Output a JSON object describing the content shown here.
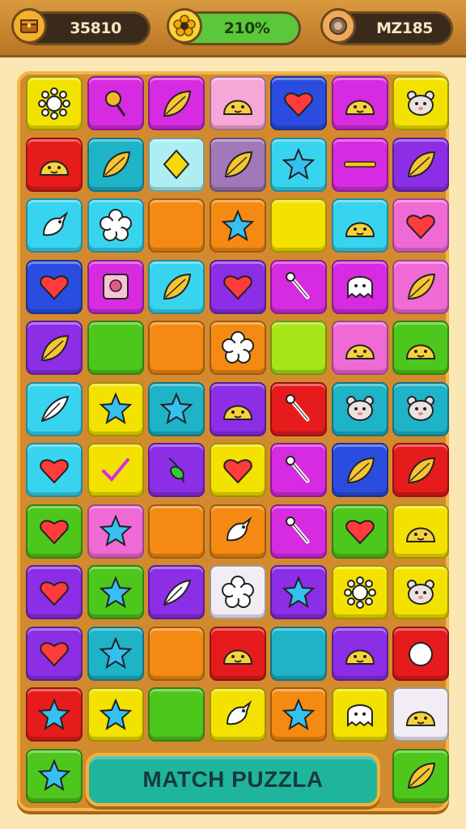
{
  "hud": {
    "coins": "35810",
    "progress": "210%",
    "level": "MZ185"
  },
  "colors": {
    "yellow": "#f3e200",
    "magenta": "#d62be0",
    "pink": "#f06ad6",
    "lightpink": "#f7a6d8",
    "blue": "#2a4de0",
    "lime": "#a8e619",
    "red": "#e61b1b",
    "teal": "#1fb3c7",
    "cyan": "#38d4ef",
    "orange": "#f58a12",
    "purple": "#8c2ee6",
    "green": "#4ec71c",
    "mauve": "#a178b8",
    "white": "#f2ecf4",
    "paleblue": "#aeeef2"
  },
  "board": {
    "rows": [
      [
        {
          "c": "yellow",
          "i": "sun"
        },
        {
          "c": "magenta",
          "i": "lollipop"
        },
        {
          "c": "magenta",
          "i": "leaf"
        },
        {
          "c": "lightpink",
          "i": "face"
        },
        {
          "c": "blue",
          "i": "heart"
        },
        {
          "c": "magenta",
          "i": "face"
        },
        {
          "c": "yellow",
          "i": "bear"
        }
      ],
      [
        {
          "c": "red",
          "i": "face"
        },
        {
          "c": "teal",
          "i": "leaf"
        },
        {
          "c": "paleblue",
          "i": "diamond"
        },
        {
          "c": "mauve",
          "i": "leaf"
        },
        {
          "c": "cyan",
          "i": "star"
        },
        {
          "c": "magenta",
          "i": "bar"
        },
        {
          "c": "purple",
          "i": "leaf"
        }
      ],
      [
        {
          "c": "cyan",
          "i": "bird"
        },
        {
          "c": "cyan",
          "i": "flower"
        },
        {
          "c": "orange",
          "i": "none"
        },
        {
          "c": "orange",
          "i": "star"
        },
        {
          "c": "yellow",
          "i": "none"
        },
        {
          "c": "cyan",
          "i": "face"
        },
        {
          "c": "pink",
          "i": "heart"
        }
      ],
      [
        {
          "c": "blue",
          "i": "heart"
        },
        {
          "c": "magenta",
          "i": "box"
        },
        {
          "c": "cyan",
          "i": "leaf"
        },
        {
          "c": "purple",
          "i": "heart"
        },
        {
          "c": "magenta",
          "i": "stick"
        },
        {
          "c": "magenta",
          "i": "ghost"
        },
        {
          "c": "pink",
          "i": "leaf"
        }
      ],
      [
        {
          "c": "purple",
          "i": "leaf"
        },
        {
          "c": "green",
          "i": "none"
        },
        {
          "c": "orange",
          "i": "none"
        },
        {
          "c": "orange",
          "i": "flower"
        },
        {
          "c": "lime",
          "i": "none"
        },
        {
          "c": "pink",
          "i": "face"
        },
        {
          "c": "green",
          "i": "face"
        }
      ],
      [
        {
          "c": "cyan",
          "i": "feather"
        },
        {
          "c": "yellow",
          "i": "star"
        },
        {
          "c": "teal",
          "i": "star"
        },
        {
          "c": "purple",
          "i": "face"
        },
        {
          "c": "red",
          "i": "stick"
        },
        {
          "c": "teal",
          "i": "bear"
        },
        {
          "c": "teal",
          "i": "bear"
        }
      ],
      [
        {
          "c": "cyan",
          "i": "heart"
        },
        {
          "c": "yellow",
          "i": "check"
        },
        {
          "c": "purple",
          "i": "sprout"
        },
        {
          "c": "yellow",
          "i": "heart"
        },
        {
          "c": "magenta",
          "i": "stick"
        },
        {
          "c": "blue",
          "i": "leaf"
        },
        {
          "c": "red",
          "i": "leaf"
        }
      ],
      [
        {
          "c": "green",
          "i": "heart"
        },
        {
          "c": "pink",
          "i": "star"
        },
        {
          "c": "orange",
          "i": "none"
        },
        {
          "c": "orange",
          "i": "bird"
        },
        {
          "c": "magenta",
          "i": "stick"
        },
        {
          "c": "green",
          "i": "heart"
        },
        {
          "c": "yellow",
          "i": "face"
        }
      ],
      [
        {
          "c": "purple",
          "i": "heart"
        },
        {
          "c": "green",
          "i": "star"
        },
        {
          "c": "purple",
          "i": "feather"
        },
        {
          "c": "white",
          "i": "flower"
        },
        {
          "c": "purple",
          "i": "star"
        },
        {
          "c": "yellow",
          "i": "sun"
        },
        {
          "c": "yellow",
          "i": "bear"
        }
      ],
      [
        {
          "c": "purple",
          "i": "heart"
        },
        {
          "c": "teal",
          "i": "star"
        },
        {
          "c": "orange",
          "i": "none"
        },
        {
          "c": "red",
          "i": "face"
        },
        {
          "c": "teal",
          "i": "none"
        },
        {
          "c": "purple",
          "i": "face"
        },
        {
          "c": "red",
          "i": "ball"
        }
      ],
      [
        {
          "c": "red",
          "i": "star"
        },
        {
          "c": "yellow",
          "i": "star"
        },
        {
          "c": "green",
          "i": "none"
        },
        {
          "c": "yellow",
          "i": "bird"
        },
        {
          "c": "orange",
          "i": "star"
        },
        {
          "c": "yellow",
          "i": "ghost"
        },
        {
          "c": "white",
          "i": "face"
        }
      ],
      [
        {
          "c": "green",
          "i": "star"
        },
        {
          "c": "none",
          "i": "none"
        },
        {
          "c": "none",
          "i": "none"
        },
        {
          "c": "none",
          "i": "none"
        },
        {
          "c": "none",
          "i": "none"
        },
        {
          "c": "none",
          "i": "none"
        },
        {
          "c": "green",
          "i": "leaf"
        }
      ]
    ]
  },
  "button": {
    "label": "MATCH PUZZLA"
  }
}
